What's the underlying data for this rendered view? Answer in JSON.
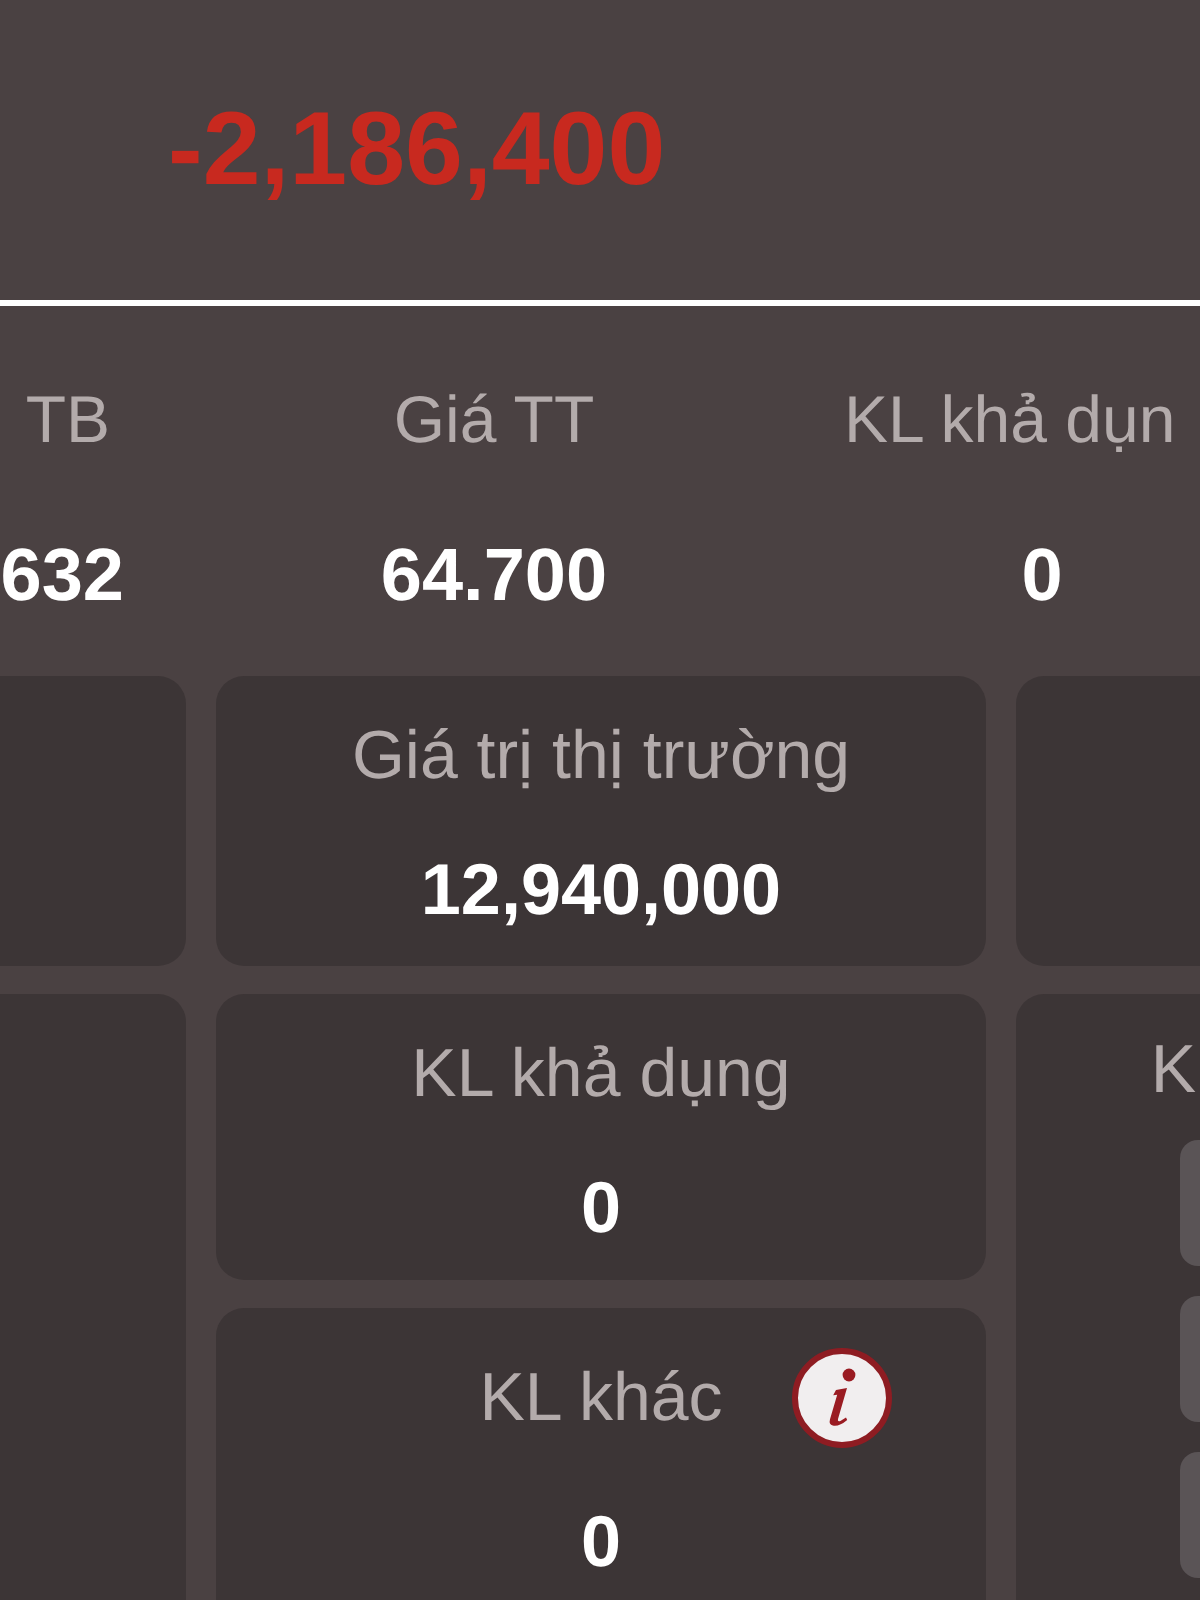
{
  "summary": {
    "amount": "-2,186,400",
    "negative": true
  },
  "stats": [
    {
      "label": "TB",
      "value": "632"
    },
    {
      "label": "Giá TT",
      "value": "64.700"
    },
    {
      "label": "KL khả dụn",
      "value": "0"
    }
  ],
  "cards": [
    {
      "label": "Giá trị thị trường",
      "value": "12,940,000",
      "info": false
    },
    {
      "label": "KL khả dụng",
      "value": "0",
      "info": false
    },
    {
      "label": "KL khác",
      "value": "0",
      "info": true
    }
  ],
  "side_panel": {
    "label": "K"
  }
}
